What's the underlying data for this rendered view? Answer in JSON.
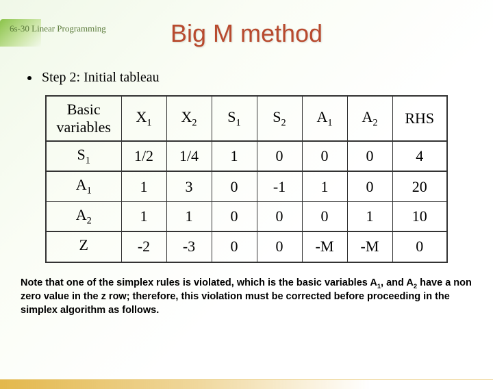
{
  "header": {
    "label": "6s-30  Linear Programming"
  },
  "title": "Big M method",
  "step": "Step 2: Initial tableau",
  "table": {
    "head": {
      "bv": "Basic variables",
      "x1": "X",
      "x1s": "1",
      "x2": "X",
      "x2s": "2",
      "s1": "S",
      "s1s": "1",
      "s2": "S",
      "s2s": "2",
      "a1": "A",
      "a1s": "1",
      "a2": "A",
      "a2s": "2",
      "rhs": "RHS"
    },
    "rows": {
      "r1": {
        "bv": "S",
        "bvs": "1",
        "c1": "1/2",
        "c2": "1/4",
        "c3": "1",
        "c4": "0",
        "c5": "0",
        "c6": "0",
        "c7": "4"
      },
      "r2": {
        "bv": "A",
        "bvs": "1",
        "c1": "1",
        "c2": "3",
        "c3": "0",
        "c4": "-1",
        "c5": "1",
        "c6": "0",
        "c7": "20"
      },
      "r3": {
        "bv": "A",
        "bvs": "2",
        "c1": "1",
        "c2": "1",
        "c3": "0",
        "c4": "0",
        "c5": "0",
        "c6": "1",
        "c7": "10"
      },
      "r4": {
        "bv": "Z",
        "bvs": "",
        "c1": "-2",
        "c2": "-3",
        "c3": "0",
        "c4": "0",
        "c5": "-M",
        "c6": "-M",
        "c7": "0"
      }
    }
  },
  "note": {
    "p1": "Note that one of the simplex rules is violated, which is the basic variables A",
    "s1": "1",
    "p2": ", and A",
    "s2": "2",
    "p3": " have a non zero value in the z row; therefore, this violation must be corrected before proceeding in the simplex algorithm as follows."
  },
  "chart_data": {
    "type": "table",
    "title": "Big M method — Step 2: Initial tableau",
    "columns": [
      "Basic variables",
      "X1",
      "X2",
      "S1",
      "S2",
      "A1",
      "A2",
      "RHS"
    ],
    "rows": [
      [
        "S1",
        "1/2",
        "1/4",
        1,
        0,
        0,
        0,
        4
      ],
      [
        "A1",
        1,
        3,
        0,
        -1,
        1,
        0,
        20
      ],
      [
        "A2",
        1,
        1,
        0,
        0,
        0,
        1,
        10
      ],
      [
        "Z",
        -2,
        -3,
        0,
        0,
        "-M",
        "-M",
        0
      ]
    ]
  }
}
